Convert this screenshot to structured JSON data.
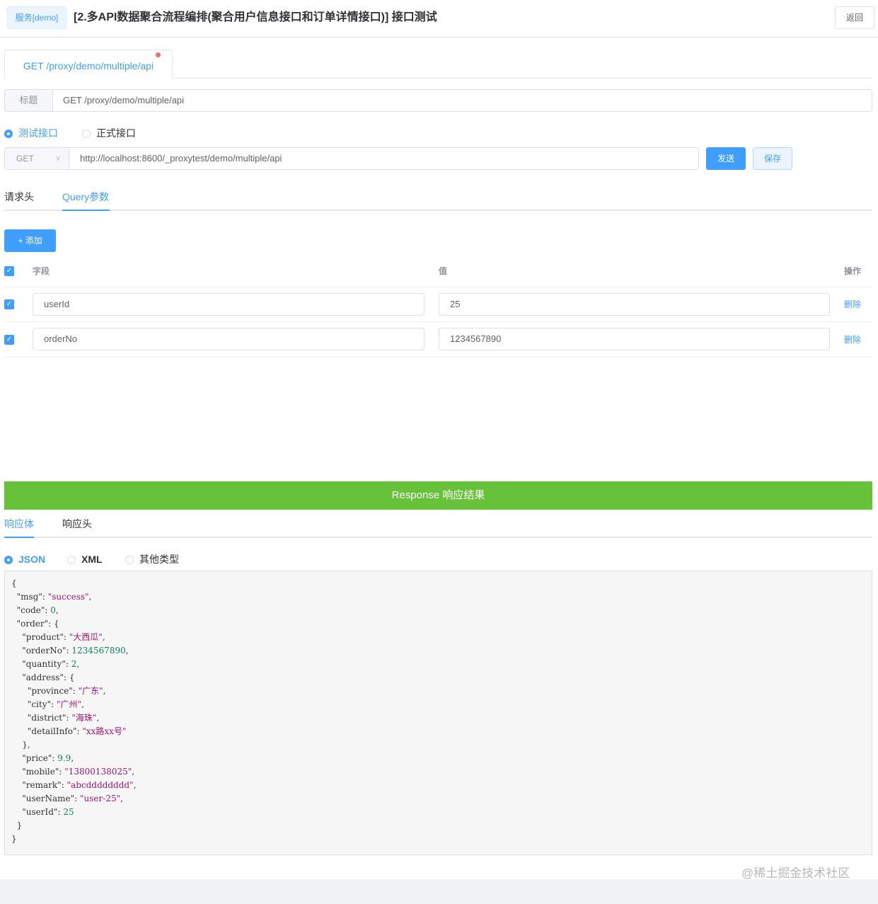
{
  "header": {
    "service_tag": "服务[demo]",
    "title": "[2.多API数据聚合流程编排(聚合用户信息接口和订单详情接口)] 接口测试",
    "back_label": "返回"
  },
  "request": {
    "tab_label": "GET /proxy/demo/multiple/api",
    "title_prefix": "标题",
    "title_value": "GET /proxy/demo/multiple/api",
    "env_options": [
      "测试接口",
      "正式接口"
    ],
    "env_selected": "测试接口",
    "method": "GET",
    "url": "http://localhost:8600/_proxytest/demo/multiple/api",
    "send_label": "发送",
    "save_label": "保存"
  },
  "param_tabs": [
    "请求头",
    "Query参数"
  ],
  "param_tab_active": "Query参数",
  "add_label": "+ 添加",
  "table": {
    "headers": {
      "field": "字段",
      "value": "值",
      "action": "操作"
    },
    "rows": [
      {
        "checked": true,
        "field": "userId",
        "value": "25",
        "action": "删除"
      },
      {
        "checked": true,
        "field": "orderNo",
        "value": "1234567890",
        "action": "删除"
      }
    ]
  },
  "response": {
    "bar_label": "Response 响应结果",
    "tabs": [
      "响应体",
      "响应头"
    ],
    "tab_active": "响应体",
    "format_options": [
      "JSON",
      "XML",
      "其他类型"
    ],
    "format_selected": "JSON",
    "body_lines": [
      [
        [
          "{",
          "k"
        ]
      ],
      [
        [
          "  \"msg\"",
          "k"
        ],
        [
          ": ",
          "k"
        ],
        [
          "\"success\"",
          "s"
        ],
        [
          ",",
          "k"
        ]
      ],
      [
        [
          "  \"code\"",
          "k"
        ],
        [
          ": ",
          "k"
        ],
        [
          "0",
          "n"
        ],
        [
          ",",
          "k"
        ]
      ],
      [
        [
          "  \"order\"",
          "k"
        ],
        [
          ": {",
          "k"
        ]
      ],
      [
        [
          "    \"product\"",
          "k"
        ],
        [
          ": ",
          "k"
        ],
        [
          "\"大西瓜\"",
          "s"
        ],
        [
          ",",
          "k"
        ]
      ],
      [
        [
          "    \"orderNo\"",
          "k"
        ],
        [
          ": ",
          "k"
        ],
        [
          "1234567890",
          "n"
        ],
        [
          ",",
          "k"
        ]
      ],
      [
        [
          "    \"quantity\"",
          "k"
        ],
        [
          ": ",
          "k"
        ],
        [
          "2",
          "n"
        ],
        [
          ",",
          "k"
        ]
      ],
      [
        [
          "    \"address\"",
          "k"
        ],
        [
          ": {",
          "k"
        ]
      ],
      [
        [
          "      \"province\"",
          "k"
        ],
        [
          ": ",
          "k"
        ],
        [
          "\"广东\"",
          "s"
        ],
        [
          ",",
          "k"
        ]
      ],
      [
        [
          "      \"city\"",
          "k"
        ],
        [
          ": ",
          "k"
        ],
        [
          "\"广州\"",
          "s"
        ],
        [
          ",",
          "k"
        ]
      ],
      [
        [
          "      \"district\"",
          "k"
        ],
        [
          ": ",
          "k"
        ],
        [
          "\"海珠\"",
          "s"
        ],
        [
          ",",
          "k"
        ]
      ],
      [
        [
          "      \"detailInfo\"",
          "k"
        ],
        [
          ": ",
          "k"
        ],
        [
          "\"xx路xx号\"",
          "s"
        ]
      ],
      [
        [
          "    },",
          "k"
        ]
      ],
      [
        [
          "    \"price\"",
          "k"
        ],
        [
          ": ",
          "k"
        ],
        [
          "9.9",
          "n"
        ],
        [
          ",",
          "k"
        ]
      ],
      [
        [
          "    \"mobile\"",
          "k"
        ],
        [
          ": ",
          "k"
        ],
        [
          "\"13800138025\"",
          "s"
        ],
        [
          ",",
          "k"
        ]
      ],
      [
        [
          "    \"remark\"",
          "k"
        ],
        [
          ": ",
          "k"
        ],
        [
          "\"abcdddddddd\"",
          "s"
        ],
        [
          ",",
          "k"
        ]
      ],
      [
        [
          "    \"userName\"",
          "k"
        ],
        [
          ": ",
          "k"
        ],
        [
          "\"user-25\"",
          "s"
        ],
        [
          ",",
          "k"
        ]
      ],
      [
        [
          "    \"userId\"",
          "k"
        ],
        [
          ": ",
          "k"
        ],
        [
          "25",
          "n"
        ]
      ],
      [
        [
          "  }",
          "k"
        ]
      ],
      [
        [
          "}",
          "k"
        ]
      ]
    ]
  },
  "watermark": "@稀土掘金技术社区",
  "colors": {
    "primary": "#409eff",
    "success": "#67c23a",
    "danger_dot": "#f56c6c",
    "string": "#a31570",
    "number": "#098658"
  }
}
